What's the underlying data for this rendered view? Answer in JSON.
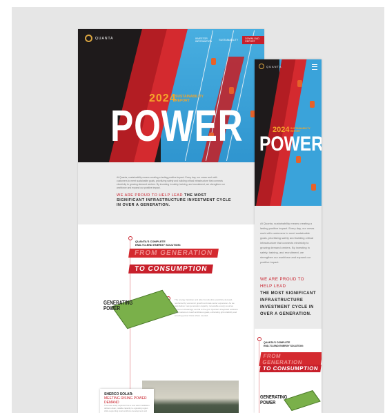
{
  "colors": {
    "brand_red": "#c8202b",
    "accent_gold": "#f4a52a",
    "sky_blue": "#3aa3da",
    "background": "#e6e6e6"
  },
  "desktop": {
    "logo_text": "QUANTA",
    "nav": [
      "INVESTOR INFORMATION",
      "SUSTAINABILITY",
      "DOWNLOAD REPORT"
    ],
    "year": "2024",
    "report_label_1": "SUSTAINABILITY",
    "report_label_2": "REPORT",
    "headline": "POWER",
    "intro_text": "At Quanta, sustainability means creating a lasting positive impact. Every day, our crews work with customers to meet sustainable goals, prioritizing safety and building critical infrastructure that connects electricity to growing demand centers. By investing in safety, training, and recruitment, we strengthen our workforce and expand our positive impact.",
    "lead_light": "WE ARE PROUD TO HELP LEAD",
    "lead_bold": "THE MOST SIGNIFICANT INFRASTRUCTURE INVESTMENT CYCLE IN OVER A GENERATION.",
    "solution_label_1": "QUANTA'S COMPLETE",
    "solution_label_2": "END-TO-END ENERGY SOLUTION:",
    "banner_1": "FROM GENERATION",
    "banner_2": "TO CONSUMPTION",
    "generating_title_1": "GENERATING",
    "generating_title_2": "POWER",
    "generating_text": "The energy transition and other trends drive electricity demand, reinforced by economic growth and data center expansion. As we help deliver new generation capacity, renewable energy sources become increasingly central to the grid. Quanta's integrated solutions help customers reach ambitious goals, enhancing grid reliability and ensuring power flows where needed.",
    "case_title": "SHERCO SOLAR:",
    "case_subtitle": "MEETING RISING POWER DEMAND",
    "case_text": "This case study explores how a new solar installation delivers clean, reliable capacity to a growing region while supporting local workforce development and long-term grid resilience."
  },
  "mobile": {
    "logo_text": "QUANTA",
    "menu_icon": "hamburger-icon",
    "year": "2024",
    "report_label_1": "SUSTAINABILITY",
    "report_label_2": "REPORT",
    "headline": "POWER",
    "intro_text": "At Quanta, sustainability means creating a lasting positive impact. Every day, our crews work with customers to meet sustainable goals, prioritizing safety and building critical infrastructure that connects electricity to growing demand centers. By investing in safety, training, and recruitment, we strengthen our workforce and expand our positive impact.",
    "lead_light": "WE ARE PROUD TO HELP LEAD",
    "lead_bold": "THE MOST SIGNIFICANT INFRASTRUCTURE INVESTMENT CYCLE IN OVER A GENERATION.",
    "solution_label_1": "QUANTA'S COMPLETE",
    "solution_label_2": "END-TO-END ENERGY SOLUTION:",
    "banner_1": "FROM GENERATION",
    "banner_2": "TO CONSUMPTION",
    "generating_title_1": "GENERATING",
    "generating_title_2": "POWER"
  }
}
